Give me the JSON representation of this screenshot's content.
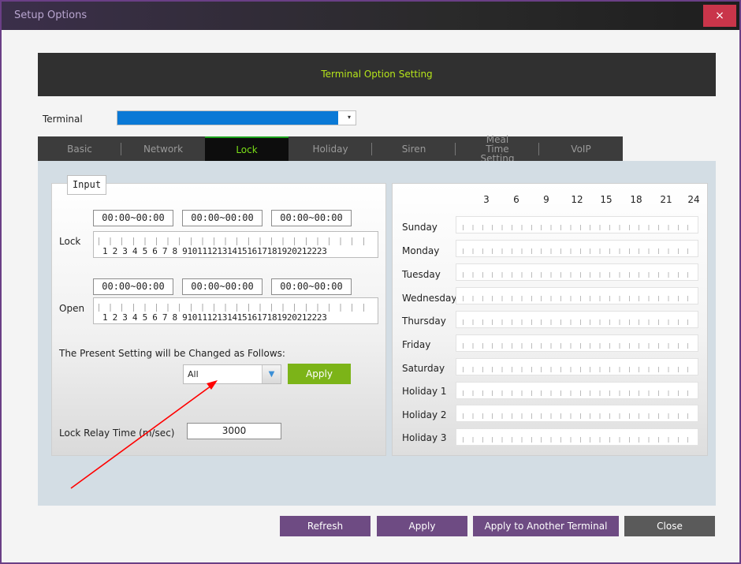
{
  "window": {
    "title": "Setup Options",
    "close_glyph": "×"
  },
  "header": {
    "title": "Terminal Option Setting"
  },
  "terminal": {
    "label": "Terminal",
    "selected": "",
    "arrow": "▾"
  },
  "tabs": [
    {
      "label": "Basic"
    },
    {
      "label": "Network"
    },
    {
      "label": "Lock"
    },
    {
      "label": "Holiday"
    },
    {
      "label": "Siren"
    },
    {
      "label": "Meal Time Setting"
    },
    {
      "label": "VoIP"
    }
  ],
  "active_tab": "Lock",
  "input_panel": {
    "tab_label": "Input",
    "lock": {
      "label": "Lock",
      "ranges": [
        "00:00~00:00",
        "00:00~00:00",
        "00:00~00:00"
      ]
    },
    "open": {
      "label": "Open",
      "ranges": [
        "00:00~00:00",
        "00:00~00:00",
        "00:00~00:00"
      ]
    },
    "ruler_numbers": "1 2 3 4 5 6 7 8 91011121314151617181920212223",
    "change_label": "The Present Setting will be Changed as Follows:",
    "scope_value": "All",
    "scope_arrow": "▼",
    "apply_label": "Apply",
    "relay_label": "Lock Relay Time (m/sec)",
    "relay_value": "3000"
  },
  "schedule": {
    "hours": [
      "3",
      "6",
      "9",
      "12",
      "15",
      "18",
      "21",
      "24"
    ],
    "days": [
      "Sunday",
      "Monday",
      "Tuesday",
      "Wednesday",
      "Thursday",
      "Friday",
      "Saturday",
      "Holiday 1",
      "Holiday 2",
      "Holiday 3"
    ]
  },
  "footer": {
    "refresh": "Refresh",
    "apply": "Apply",
    "apply_another": "Apply to Another Terminal",
    "close": "Close"
  },
  "colors": {
    "accent_green": "#7cb418",
    "tab_active_text": "#7adf17",
    "header_text": "#b6e61a",
    "purple_button": "#6e4b83",
    "close_red": "#c9354a",
    "annotation_arrow": "#ff0000"
  },
  "icons": {
    "close": "close-icon",
    "dropdown": "chevron-down-icon"
  }
}
